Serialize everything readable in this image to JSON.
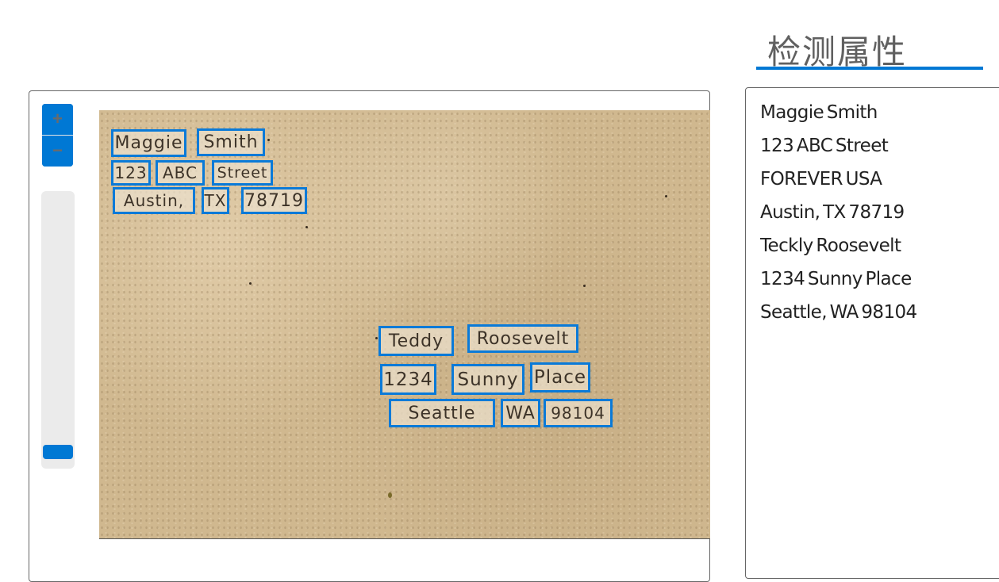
{
  "header": {
    "title": "检测属性"
  },
  "viewer": {
    "zoom_in_label": "+",
    "zoom_out_label": "−",
    "zoom_slider_value": 0.0,
    "document_image": "handwritten-envelope",
    "detected_words": [
      {
        "text": "Maggie",
        "size": 22
      },
      {
        "text": "Smith",
        "size": 22
      },
      {
        "text": "123",
        "size": 20
      },
      {
        "text": "ABC",
        "size": 20
      },
      {
        "text": "Street",
        "size": 19
      },
      {
        "text": "Austin,",
        "size": 20
      },
      {
        "text": "TX",
        "size": 20
      },
      {
        "text": "78719",
        "size": 22
      },
      {
        "text": "Teddy",
        "size": 22
      },
      {
        "text": "Roosevelt",
        "size": 22
      },
      {
        "text": "1234",
        "size": 23
      },
      {
        "text": "Sunny",
        "size": 23
      },
      {
        "text": "Place",
        "size": 23
      },
      {
        "text": "Seattle",
        "size": 22
      },
      {
        "text": "WA",
        "size": 22
      },
      {
        "text": "98104",
        "size": 20
      }
    ]
  },
  "results": {
    "lines": [
      "Maggie Smith",
      "123 ABC Street",
      "FOREVER USA",
      "Austin, TX 78719",
      "Teckly Roosevelt",
      "1234 Sunny Place",
      "Seattle, WA 98104"
    ]
  },
  "colors": {
    "accent": "#0078d4",
    "paper": "#d0b88f",
    "header_text": "#606060"
  }
}
